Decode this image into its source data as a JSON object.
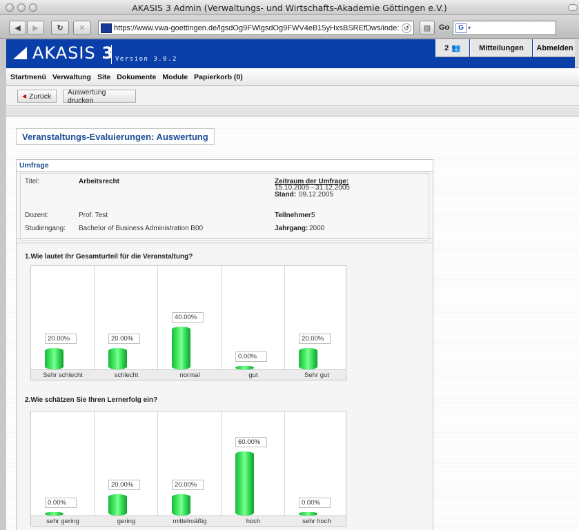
{
  "window": {
    "title": "AKASIS 3 Admin (Verwaltungs- und Wirtschafts-Akademie Göttingen e.V.)"
  },
  "browser": {
    "url": "https://www.vwa-goettingen.de/lgsdOg9FWlgsdOg9FWV4eB15yHxsBSREfDws/inde:",
    "go_label": "Go",
    "search_engine": "G"
  },
  "header": {
    "logo_text": "AKASIS",
    "logo_number": "3",
    "version": "Version 3.0.2",
    "user_count": "2",
    "messages_label": "Mitteilungen",
    "logout_label": "Abmelden",
    "brand_color": "#0a3ea8"
  },
  "menu": {
    "items": [
      "Startmenü",
      "Verwaltung",
      "Site",
      "Dokumente",
      "Module",
      "Papierkorb (0)"
    ]
  },
  "actions": {
    "back_label": "Zurück",
    "print_label": "Auswertung drucken"
  },
  "page": {
    "heading": "Veranstaltungs-Evaluierungen: Auswertung"
  },
  "survey": {
    "panel_title": "Umfrage",
    "title_label": "Titel:",
    "title_value": "Arbeitsrecht",
    "period_label": "Zeitraum der Umfrage:",
    "period_value": "15.10.2005 - 31.12.2005",
    "stand_label": "Stand:",
    "stand_value": "09.12.2005",
    "lecturer_label": "Dozent:",
    "lecturer_value": "Prof. Test",
    "participants_label": "Teilnehmer:",
    "participants_value": "5",
    "program_label": "Studiengang:",
    "program_value": "Bachelor of Business Administration B00",
    "year_label": "Jahrgang:",
    "year_value": "2000"
  },
  "questions": [
    {
      "text": "1.Wie lautet Ihr Gesamturteil für die Veranstaltung?",
      "answers": [
        {
          "label": "Sehr schlecht",
          "percent": 20,
          "display": "20.00%"
        },
        {
          "label": "schlecht",
          "percent": 20,
          "display": "20.00%"
        },
        {
          "label": "normal",
          "percent": 40,
          "display": "40.00%"
        },
        {
          "label": "gut",
          "percent": 0,
          "display": "0.00%"
        },
        {
          "label": "Sehr gut",
          "percent": 20,
          "display": "20.00%"
        }
      ]
    },
    {
      "text": "2.Wie schätzen Sie Ihren Lernerfolg ein?",
      "answers": [
        {
          "label": "sehr gering",
          "percent": 0,
          "display": "0.00%"
        },
        {
          "label": "gering",
          "percent": 20,
          "display": "20.00%"
        },
        {
          "label": "mittelmäßig",
          "percent": 20,
          "display": "20.00%"
        },
        {
          "label": "hoch",
          "percent": 60,
          "display": "60.00%"
        },
        {
          "label": "sehr hoch",
          "percent": 0,
          "display": "0.00%"
        }
      ]
    }
  ],
  "colors": {
    "bar": "#2fd752",
    "heading": "#1c4f96"
  }
}
